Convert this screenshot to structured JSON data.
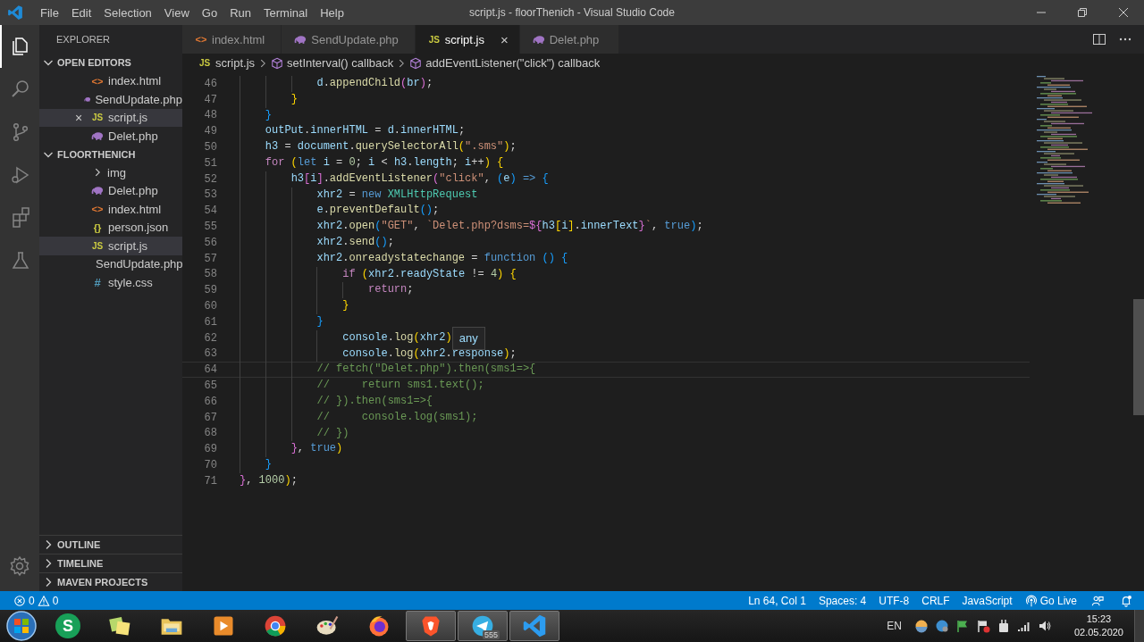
{
  "window": {
    "title": "script.js - floorThenich - Visual Studio Code",
    "menu": [
      "File",
      "Edit",
      "Selection",
      "View",
      "Go",
      "Run",
      "Terminal",
      "Help"
    ]
  },
  "activity_bar": [
    {
      "selected": true
    },
    {
      "selected": false
    },
    {
      "selected": false
    },
    {
      "selected": false
    },
    {
      "selected": false
    },
    {
      "selected": false
    }
  ],
  "sidebar": {
    "title": "EXPLORER",
    "open_editors": {
      "title": "OPEN EDITORS",
      "expanded": true,
      "items": [
        {
          "name": "index.html",
          "kind": "html",
          "glyph": "<>",
          "selected": false
        },
        {
          "name": "SendUpdate.php",
          "kind": "php",
          "selected": false
        },
        {
          "name": "script.js",
          "kind": "js",
          "glyph": "JS",
          "selected": true,
          "close": "×"
        },
        {
          "name": "Delet.php",
          "kind": "php",
          "selected": false
        }
      ]
    },
    "folder": {
      "title": "FLOORTHENICH",
      "expanded": true,
      "items": [
        {
          "name": "img",
          "kind": "folder",
          "expanded": false,
          "selected": false
        },
        {
          "name": "Delet.php",
          "kind": "php",
          "selected": false
        },
        {
          "name": "index.html",
          "kind": "html",
          "glyph": "<>",
          "selected": false
        },
        {
          "name": "person.json",
          "kind": "json",
          "glyph": "{}",
          "selected": false
        },
        {
          "name": "script.js",
          "kind": "js",
          "glyph": "JS",
          "selected": true
        },
        {
          "name": "SendUpdate.php",
          "kind": "php",
          "selected": false
        },
        {
          "name": "style.css",
          "kind": "css",
          "glyph": "#",
          "selected": false
        }
      ]
    },
    "panels": [
      {
        "title": "OUTLINE",
        "expanded": false
      },
      {
        "title": "TIMELINE",
        "expanded": false
      },
      {
        "title": "MAVEN PROJECTS",
        "expanded": false
      }
    ]
  },
  "tabs": [
    {
      "label": "index.html",
      "kind": "html",
      "glyph": "<>",
      "selected": false
    },
    {
      "label": "SendUpdate.php",
      "kind": "php",
      "selected": false
    },
    {
      "label": "script.js",
      "kind": "js",
      "glyph": "JS",
      "selected": true,
      "close": "×"
    },
    {
      "label": "Delet.php",
      "kind": "php",
      "selected": false
    }
  ],
  "breadcrumb": [
    {
      "label": "script.js",
      "kind": "js",
      "glyph": "JS"
    },
    {
      "label": "setInterval() callback",
      "kind": "method"
    },
    {
      "label": "addEventListener(\"click\") callback",
      "kind": "method"
    }
  ],
  "editor": {
    "lines": [
      {
        "n": "46",
        "current": false,
        "tokens": [
          {
            "t": "            d",
            "kind": "var"
          },
          {
            "t": ".",
            "kind": "p"
          },
          {
            "t": "appendChild",
            "kind": "fn"
          },
          {
            "t": "(",
            "kind": "b2"
          },
          {
            "t": "br",
            "kind": "var"
          },
          {
            "t": ")",
            "kind": "b2"
          },
          {
            "t": ";",
            "kind": "p"
          }
        ]
      },
      {
        "n": "47",
        "current": false,
        "tokens": [
          {
            "t": "        }",
            "kind": "b1"
          }
        ]
      },
      {
        "n": "48",
        "current": false,
        "tokens": [
          {
            "t": "    }",
            "kind": "b3"
          }
        ]
      },
      {
        "n": "49",
        "current": false,
        "tokens": [
          {
            "t": "    outPut",
            "kind": "var"
          },
          {
            "t": ".",
            "kind": "p"
          },
          {
            "t": "innerHTML",
            "kind": "var"
          },
          {
            "t": " = ",
            "kind": "p"
          },
          {
            "t": "d",
            "kind": "var"
          },
          {
            "t": ".",
            "kind": "p"
          },
          {
            "t": "innerHTML",
            "kind": "var"
          },
          {
            "t": ";",
            "kind": "p"
          }
        ]
      },
      {
        "n": "50",
        "current": false,
        "tokens": [
          {
            "t": "    h3",
            "kind": "var"
          },
          {
            "t": " = ",
            "kind": "p"
          },
          {
            "t": "document",
            "kind": "var"
          },
          {
            "t": ".",
            "kind": "p"
          },
          {
            "t": "querySelectorAll",
            "kind": "fn"
          },
          {
            "t": "(",
            "kind": "b1"
          },
          {
            "t": "\".sms\"",
            "kind": "str"
          },
          {
            "t": ")",
            "kind": "b1"
          },
          {
            "t": ";",
            "kind": "p"
          }
        ]
      },
      {
        "n": "51",
        "current": false,
        "tokens": [
          {
            "t": "    for",
            "kind": "ctl"
          },
          {
            "t": " (",
            "kind": "b1"
          },
          {
            "t": "let",
            "kind": "kw"
          },
          {
            "t": " i",
            "kind": "var"
          },
          {
            "t": " = ",
            "kind": "p"
          },
          {
            "t": "0",
            "kind": "num"
          },
          {
            "t": "; ",
            "kind": "p"
          },
          {
            "t": "i",
            "kind": "var"
          },
          {
            "t": " < ",
            "kind": "p"
          },
          {
            "t": "h3",
            "kind": "var"
          },
          {
            "t": ".",
            "kind": "p"
          },
          {
            "t": "length",
            "kind": "var"
          },
          {
            "t": "; ",
            "kind": "p"
          },
          {
            "t": "i",
            "kind": "var"
          },
          {
            "t": "++",
            "kind": "p"
          },
          {
            "t": ")",
            "kind": "b1"
          },
          {
            "t": " {",
            "kind": "b1"
          }
        ]
      },
      {
        "n": "52",
        "current": false,
        "tokens": [
          {
            "t": "        h3",
            "kind": "var"
          },
          {
            "t": "[",
            "kind": "b2"
          },
          {
            "t": "i",
            "kind": "var"
          },
          {
            "t": "]",
            "kind": "b2"
          },
          {
            "t": ".",
            "kind": "p"
          },
          {
            "t": "addEventListener",
            "kind": "fn"
          },
          {
            "t": "(",
            "kind": "b2"
          },
          {
            "t": "\"click\"",
            "kind": "str"
          },
          {
            "t": ", ",
            "kind": "p"
          },
          {
            "t": "(",
            "kind": "b3"
          },
          {
            "t": "e",
            "kind": "var"
          },
          {
            "t": ")",
            "kind": "b3"
          },
          {
            "t": " =>",
            "kind": "kw"
          },
          {
            "t": " {",
            "kind": "b3"
          }
        ]
      },
      {
        "n": "53",
        "current": false,
        "tokens": [
          {
            "t": "            xhr2",
            "kind": "var"
          },
          {
            "t": " = ",
            "kind": "p"
          },
          {
            "t": "new",
            "kind": "kw"
          },
          {
            "t": " XMLHttpRequest",
            "kind": "type"
          }
        ]
      },
      {
        "n": "54",
        "current": false,
        "tokens": [
          {
            "t": "            e",
            "kind": "var"
          },
          {
            "t": ".",
            "kind": "p"
          },
          {
            "t": "preventDefault",
            "kind": "fn"
          },
          {
            "t": "()",
            "kind": "b3"
          },
          {
            "t": ";",
            "kind": "p"
          }
        ]
      },
      {
        "n": "55",
        "current": false,
        "tokens": [
          {
            "t": "            xhr2",
            "kind": "var"
          },
          {
            "t": ".",
            "kind": "p"
          },
          {
            "t": "open",
            "kind": "fn"
          },
          {
            "t": "(",
            "kind": "b3"
          },
          {
            "t": "\"GET\"",
            "kind": "str"
          },
          {
            "t": ", ",
            "kind": "p"
          },
          {
            "t": "`Delet.php?dsms=",
            "kind": "str"
          },
          {
            "t": "${",
            "kind": "b2"
          },
          {
            "t": "h3",
            "kind": "var"
          },
          {
            "t": "[",
            "kind": "b1"
          },
          {
            "t": "i",
            "kind": "var"
          },
          {
            "t": "]",
            "kind": "b1"
          },
          {
            "t": ".",
            "kind": "p"
          },
          {
            "t": "innerText",
            "kind": "var"
          },
          {
            "t": "}",
            "kind": "b2"
          },
          {
            "t": "`",
            "kind": "str"
          },
          {
            "t": ", ",
            "kind": "p"
          },
          {
            "t": "true",
            "kind": "kw"
          },
          {
            "t": ")",
            "kind": "b3"
          },
          {
            "t": ";",
            "kind": "p"
          }
        ]
      },
      {
        "n": "56",
        "current": false,
        "tokens": [
          {
            "t": "            xhr2",
            "kind": "var"
          },
          {
            "t": ".",
            "kind": "p"
          },
          {
            "t": "send",
            "kind": "fn"
          },
          {
            "t": "()",
            "kind": "b3"
          },
          {
            "t": ";",
            "kind": "p"
          }
        ]
      },
      {
        "n": "57",
        "current": false,
        "tokens": [
          {
            "t": "            xhr2",
            "kind": "var"
          },
          {
            "t": ".",
            "kind": "p"
          },
          {
            "t": "onreadystatechange",
            "kind": "fn"
          },
          {
            "t": " = ",
            "kind": "p"
          },
          {
            "t": "function",
            "kind": "kw"
          },
          {
            "t": " ()",
            "kind": "b3"
          },
          {
            "t": " {",
            "kind": "b3"
          }
        ]
      },
      {
        "n": "58",
        "current": false,
        "tokens": [
          {
            "t": "                if",
            "kind": "ctl"
          },
          {
            "t": " (",
            "kind": "b1"
          },
          {
            "t": "xhr2",
            "kind": "var"
          },
          {
            "t": ".",
            "kind": "p"
          },
          {
            "t": "readyState",
            "kind": "var"
          },
          {
            "t": " != ",
            "kind": "p"
          },
          {
            "t": "4",
            "kind": "num"
          },
          {
            "t": ")",
            "kind": "b1"
          },
          {
            "t": " {",
            "kind": "b1"
          }
        ]
      },
      {
        "n": "59",
        "current": false,
        "tokens": [
          {
            "t": "                    return",
            "kind": "ctl"
          },
          {
            "t": ";",
            "kind": "p"
          }
        ]
      },
      {
        "n": "60",
        "current": false,
        "tokens": [
          {
            "t": "                }",
            "kind": "b1"
          }
        ]
      },
      {
        "n": "61",
        "current": false,
        "tokens": [
          {
            "t": "            }",
            "kind": "b3"
          }
        ]
      },
      {
        "n": "62",
        "current": false,
        "hover": "any",
        "tokens": [
          {
            "t": "                console",
            "kind": "var"
          },
          {
            "t": ".",
            "kind": "p"
          },
          {
            "t": "log",
            "kind": "fn"
          },
          {
            "t": "(",
            "kind": "b1"
          },
          {
            "t": "xhr2",
            "kind": "var"
          },
          {
            "t": ")",
            "kind": "b1"
          }
        ]
      },
      {
        "n": "63",
        "current": false,
        "tokens": [
          {
            "t": "                console",
            "kind": "var"
          },
          {
            "t": ".",
            "kind": "p"
          },
          {
            "t": "log",
            "kind": "fn"
          },
          {
            "t": "(",
            "kind": "b1"
          },
          {
            "t": "xhr2",
            "kind": "var"
          },
          {
            "t": ".",
            "kind": "p"
          },
          {
            "t": "response",
            "kind": "var"
          },
          {
            "t": ")",
            "kind": "b1"
          },
          {
            "t": ";",
            "kind": "p"
          }
        ]
      },
      {
        "n": "64",
        "current": true,
        "tokens": [
          {
            "t": "            // fetch(\"Delet.php\").then(sms1=>{",
            "kind": "cmt"
          }
        ]
      },
      {
        "n": "65",
        "current": false,
        "tokens": [
          {
            "t": "            //     return sms1.text();",
            "kind": "cmt"
          }
        ]
      },
      {
        "n": "66",
        "current": false,
        "tokens": [
          {
            "t": "            // }).then(sms1=>{",
            "kind": "cmt"
          }
        ]
      },
      {
        "n": "67",
        "current": false,
        "tokens": [
          {
            "t": "            //     console.log(sms1);",
            "kind": "cmt"
          }
        ]
      },
      {
        "n": "68",
        "current": false,
        "tokens": [
          {
            "t": "            // })",
            "kind": "cmt"
          }
        ]
      },
      {
        "n": "69",
        "current": false,
        "tokens": [
          {
            "t": "        }",
            "kind": "b2"
          },
          {
            "t": ", ",
            "kind": "p"
          },
          {
            "t": "true",
            "kind": "kw"
          },
          {
            "t": ")",
            "kind": "b1"
          }
        ]
      },
      {
        "n": "70",
        "current": false,
        "tokens": [
          {
            "t": "    }",
            "kind": "b3"
          }
        ]
      },
      {
        "n": "71",
        "current": false,
        "tokens": [
          {
            "t": "}",
            "kind": "b2"
          },
          {
            "t": ", ",
            "kind": "p"
          },
          {
            "t": "1000",
            "kind": "num"
          },
          {
            "t": ")",
            "kind": "b1"
          },
          {
            "t": ";",
            "kind": "p"
          }
        ]
      }
    ]
  },
  "status_bar": {
    "errors": "0",
    "warnings": "0",
    "items": [
      {
        "label": "Ln 64, Col 1",
        "kind": "text"
      },
      {
        "label": "Spaces: 4",
        "kind": "text"
      },
      {
        "label": "UTF-8",
        "kind": "text"
      },
      {
        "label": "CRLF",
        "kind": "text"
      },
      {
        "label": "JavaScript",
        "kind": "text"
      },
      {
        "label": "Go Live",
        "kind": "live"
      }
    ]
  },
  "taskbar": {
    "apps": [
      {
        "running": false,
        "glyph": "S"
      },
      {
        "running": false
      },
      {
        "running": false
      },
      {
        "running": false
      },
      {
        "running": false
      },
      {
        "running": false
      },
      {
        "running": false
      },
      {
        "running": true
      },
      {
        "running": true,
        "badge": "555"
      },
      {
        "running": true
      }
    ],
    "language": "EN",
    "time": "15:23",
    "date": "02.05.2020"
  }
}
